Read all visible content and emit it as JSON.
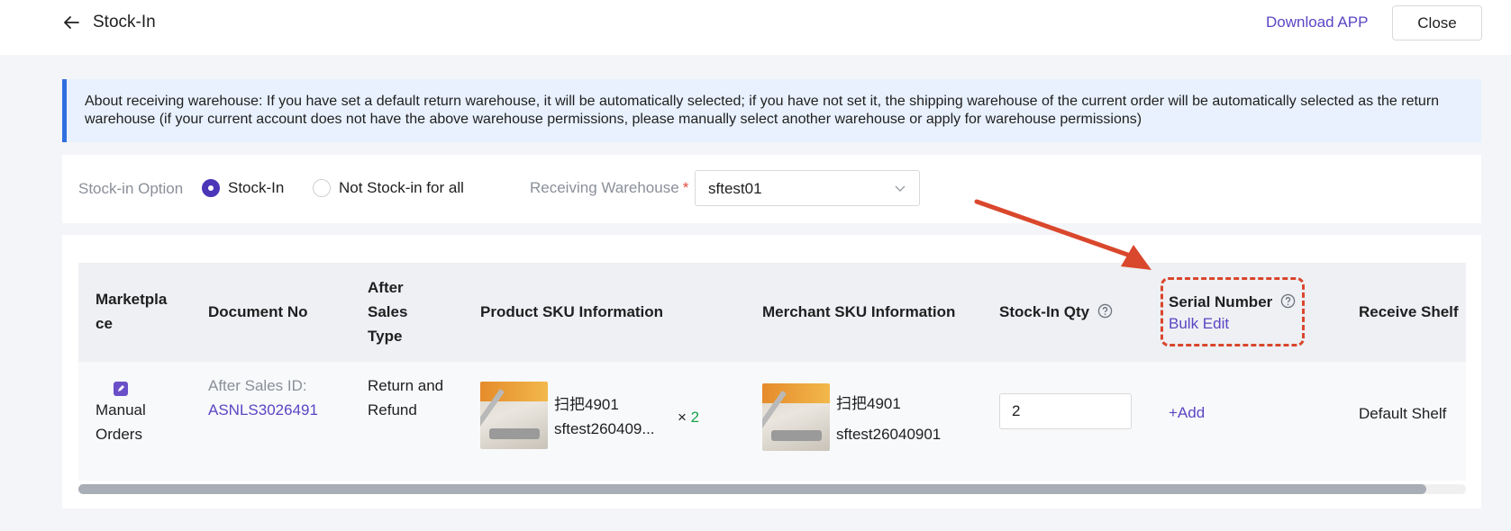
{
  "header": {
    "title": "Stock-In",
    "download_label": "Download APP",
    "close_label": "Close"
  },
  "notice": {
    "text": "About receiving warehouse: If you have set a default return warehouse, it will be automatically selected; if you have not set it, the shipping warehouse of the current order will be automatically selected as the return warehouse (if your current account does not have the above warehouse permissions, please manually select another warehouse or apply for warehouse permissions)"
  },
  "options": {
    "label": "Stock-in Option",
    "radio_stock_in": "Stock-In",
    "radio_not_stock_in": "Not Stock-in for all",
    "selected": "Stock-In",
    "warehouse_label": "Receiving Warehouse",
    "required_mark": "*",
    "warehouse_value": "sftest01"
  },
  "table": {
    "columns": {
      "marketplace_1": "Marketpla",
      "marketplace_2": "ce",
      "document_no": "Document No",
      "after_sales_1": "After",
      "after_sales_2": "Sales",
      "after_sales_3": "Type",
      "product_sku": "Product SKU Information",
      "merchant_sku": "Merchant SKU Information",
      "stock_in_qty": "Stock-In Qty",
      "serial_number": "Serial Number",
      "bulk_edit": "Bulk Edit",
      "receive_shelf": "Receive Shelf"
    },
    "row": {
      "marketplace_1": "Manual",
      "marketplace_2": "Orders",
      "after_sales_id_label": "After Sales ID:",
      "after_sales_id": "ASNLS3026491",
      "type_1": "Return and",
      "type_2": "Refund",
      "product_name": "扫把4901",
      "product_sku": "sftest260409...",
      "times": "×",
      "quantity": "2",
      "merchant_name": "扫把4901",
      "merchant_sku": "sftest26040901",
      "stock_in_qty": "2",
      "add_label": "+Add",
      "shelf": "Default Shelf"
    }
  },
  "colors": {
    "accent": "#5b45c4",
    "notice_bg": "#e8f1fd",
    "annotation": "#d9472c",
    "quantity_green": "#16a34a"
  }
}
